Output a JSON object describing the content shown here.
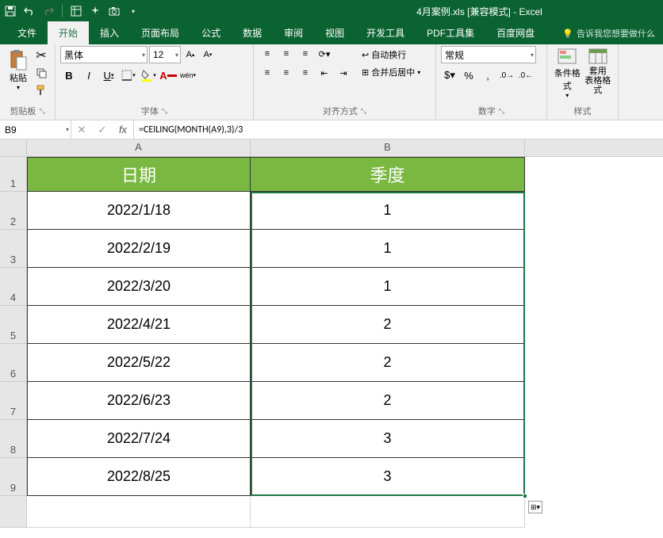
{
  "title": "4月案例.xls  [兼容模式] - Excel",
  "tabs": {
    "file": "文件",
    "home": "开始",
    "insert": "插入",
    "layout": "页面布局",
    "formulas": "公式",
    "data": "数据",
    "review": "审阅",
    "view": "视图",
    "developer": "开发工具",
    "pdf": "PDF工具集",
    "baidu": "百度网盘"
  },
  "tell_me": "告诉我您想要做什么",
  "clipboard": {
    "paste": "粘贴",
    "label": "剪贴板"
  },
  "font": {
    "name": "黑体",
    "size": "12",
    "label": "字体",
    "wen": "wén"
  },
  "alignment": {
    "wrap": "自动换行",
    "merge": "合并后居中",
    "label": "对齐方式"
  },
  "number": {
    "format": "常规",
    "label": "数字"
  },
  "styles": {
    "cond": "条件格式",
    "table": "套用\n表格格式",
    "label": "样式"
  },
  "name_box": "B9",
  "formula": "=CEILING(MONTH(A9),3)/3",
  "fx_label": "fx",
  "columns": [
    "A",
    "B"
  ],
  "headers": {
    "a": "日期",
    "b": "季度"
  },
  "rows": [
    {
      "n": "1"
    },
    {
      "n": "2",
      "a": "2022/1/18",
      "b": "1"
    },
    {
      "n": "3",
      "a": "2022/2/19",
      "b": "1"
    },
    {
      "n": "4",
      "a": "2022/3/20",
      "b": "1"
    },
    {
      "n": "5",
      "a": "2022/4/21",
      "b": "2"
    },
    {
      "n": "6",
      "a": "2022/5/22",
      "b": "2"
    },
    {
      "n": "7",
      "a": "2022/6/23",
      "b": "2"
    },
    {
      "n": "8",
      "a": "2022/7/24",
      "b": "3"
    },
    {
      "n": "9",
      "a": "2022/8/25",
      "b": "3"
    }
  ]
}
